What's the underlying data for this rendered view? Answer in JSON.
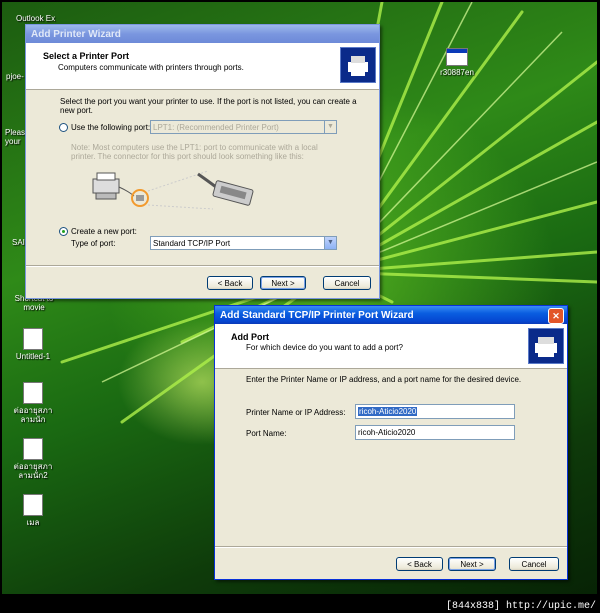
{
  "desktop": {
    "icons": [
      {
        "label": "Outlook Ex"
      },
      {
        "label": "pjoe-"
      },
      {
        "label": "Please your"
      },
      {
        "label": "SAI"
      },
      {
        "label": "Shortcut to movie"
      },
      {
        "label": "Untitled-1"
      },
      {
        "label": "ต่ออายุสภา ลามนัก"
      },
      {
        "label": "ต่ออายุสภา ลามนัก2"
      },
      {
        "label": "เมล"
      },
      {
        "label": "r30887en"
      }
    ],
    "watermark": "[844x838] http://upic.me/"
  },
  "printer_wizard": {
    "title": "Add Printer Wizard",
    "header_title": "Select a Printer Port",
    "header_subtitle": "Computers communicate with printers through ports.",
    "instruction": "Select the port you want your printer to use.  If the port is not listed, you can create a new port.",
    "use_port_label": "Use the following port:",
    "use_port_value": "LPT1: (Recommended Printer Port)",
    "note": "Note: Most computers use the LPT1: port to communicate with a local printer. The connector for this port should look something like this:",
    "create_port_label": "Create a new port:",
    "type_of_port_label": "Type of port:",
    "type_of_port_value": "Standard TCP/IP Port",
    "back_label": "< Back",
    "next_label": "Next >",
    "cancel_label": "Cancel"
  },
  "tcpip_wizard": {
    "title": "Add Standard TCP/IP Printer Port Wizard",
    "close_glyph": "✕",
    "header_title": "Add Port",
    "header_subtitle": "For which device do you want to add a port?",
    "instruction": "Enter the Printer Name or IP address, and a port name for the desired device.",
    "printer_name_label": "Printer Name or IP Address:",
    "printer_name_value": "ricoh-Aticio2020",
    "port_name_label": "Port Name:",
    "port_name_value": "ricoh-Aticio2020",
    "back_label": "< Back",
    "next_label": "Next >",
    "cancel_label": "Cancel"
  }
}
